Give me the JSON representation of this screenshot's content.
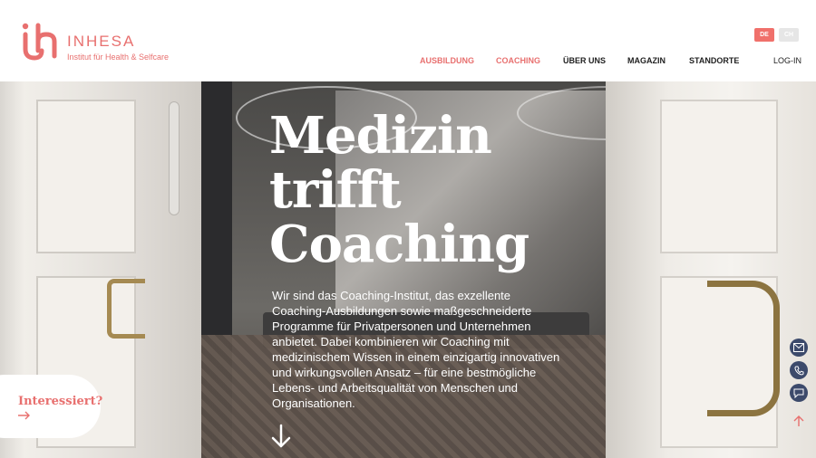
{
  "brand": {
    "name": "INHESA",
    "tagline": "Institut für Health & Selfcare"
  },
  "languages": [
    {
      "label": "DE",
      "active": true
    },
    {
      "label": "CH",
      "active": false
    }
  ],
  "nav": {
    "items": [
      {
        "label": "AUSBILDUNG",
        "active": true
      },
      {
        "label": "COACHING",
        "active": true
      },
      {
        "label": "ÜBER UNS",
        "active": false
      },
      {
        "label": "MAGAZIN",
        "active": false
      },
      {
        "label": "STANDORTE",
        "active": false
      }
    ],
    "login": "LOG-IN"
  },
  "hero": {
    "title_line1": "Medizin",
    "title_line2": "trifft",
    "title_line3": "Coaching",
    "text": "Wir sind das Coaching-Institut, das exzellente Coaching-Ausbildungen sowie maßgeschneiderte Programme für Privatpersonen und Unternehmen anbietet. Dabei kombinieren wir Coaching mit medizinischem Wissen in einem einzigartig innovativen und wirkungsvollen Ansatz – für eine bestmögliche Lebens- und Arbeitsqualität von Menschen und Organisationen."
  },
  "cta": {
    "label": "Interessiert?"
  },
  "side_actions": [
    {
      "icon": "mail-icon"
    },
    {
      "icon": "phone-icon"
    },
    {
      "icon": "chat-icon"
    }
  ],
  "colors": {
    "accent": "#e8706f",
    "side_button": "#3c4a6b"
  }
}
